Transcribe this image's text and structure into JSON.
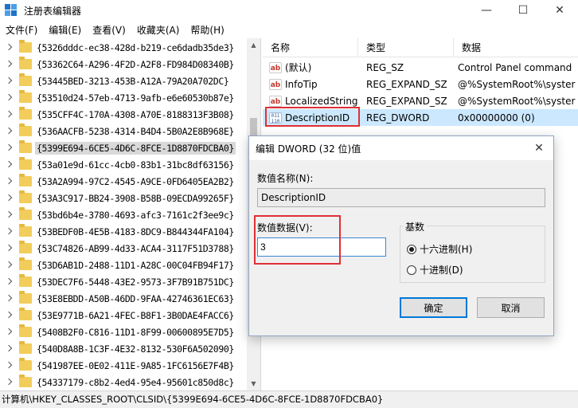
{
  "window": {
    "title": "注册表编辑器",
    "minimize": "—",
    "maximize": "☐",
    "close": "✕"
  },
  "menu": [
    "文件(F)",
    "编辑(E)",
    "查看(V)",
    "收藏夹(A)",
    "帮助(H)"
  ],
  "tree": {
    "selected_index": 7,
    "items": [
      "{5326dddc-ec38-428d-b219-ce6dadb35de3}",
      "{53362C64-A296-4F2D-A2F8-FD984D08340B}",
      "{53445BED-3213-453B-A12A-79A20A702DC}",
      "{53510d24-57eb-4713-9afb-e6e60530b87e}",
      "{535CFF4C-170A-4308-A70E-8188313F3B08}",
      "{536AACFB-5238-4314-B4D4-5B0A2E8B968E}",
      "{5399E694-6CE5-4D6C-8FCE-1D8870FDCBA0}",
      "{53a01e9d-61cc-4cb0-83b1-31bc8df63156}",
      "{53A2A994-97C2-4545-A9CE-0FD6405EA2B2}",
      "{53A3C917-BB24-3908-B58B-09ECDA99265F}",
      "{53bd6b4e-3780-4693-afc3-7161c2f3ee9c}",
      "{53BEDF0B-4E5B-4183-8DC9-B844344FA104}",
      "{53C74826-AB99-4d33-ACA4-3117F51D3788}",
      "{53D6AB1D-2488-11D1-A28C-00C04FB94F17}",
      "{53DEC7F6-5448-43E2-9573-3F7B91B751DC}",
      "{53E8EBDD-A50B-46DD-9FAA-42746361EC63}",
      "{53E9771B-6A21-4FEC-B8F1-3B0DAE4FACC6}",
      "{5408B2F0-C816-11D1-8F99-00600895E7D5}",
      "{540D8A8B-1C3F-4E32-8132-530F6A502090}",
      "{541987EE-0E02-411E-9A85-1FC6156E7F4B}",
      "{54337179-c8b2-4ed4-95e4-95601c850d8c}"
    ]
  },
  "values": {
    "headers": [
      "名称",
      "类型",
      "数据"
    ],
    "rows": [
      {
        "icon": "ab",
        "name": "(默认)",
        "type": "REG_SZ",
        "data": "Control Panel command"
      },
      {
        "icon": "ab",
        "name": "InfoTip",
        "type": "REG_EXPAND_SZ",
        "data": "@%SystemRoot%\\syster"
      },
      {
        "icon": "ab",
        "name": "LocalizedString",
        "type": "REG_EXPAND_SZ",
        "data": "@%SystemRoot%\\syster"
      },
      {
        "icon": "bin",
        "name": "DescriptionID",
        "type": "REG_DWORD",
        "data": "0x00000000 (0)"
      }
    ],
    "selected_index": 3
  },
  "icons": {
    "string_value": "ab",
    "binary_value": "011 110"
  },
  "statusbar": "计算机\\HKEY_CLASSES_ROOT\\CLSID\\{5399E694-6CE5-4D6C-8FCE-1D8870FDCBA0}",
  "dialog": {
    "title": "编辑 DWORD (32 位)值",
    "close": "✕",
    "name_label": "数值名称(N):",
    "name_value": "DescriptionID",
    "data_label": "数值数据(V):",
    "data_value": "3",
    "base_label": "基数",
    "hex_label": "十六进制(H)",
    "dec_label": "十进制(D)",
    "ok_label": "确定",
    "cancel_label": "取消"
  },
  "colors": {
    "highlight": "#e02f35",
    "selection": "#cce8ff",
    "accent": "#0078d7"
  }
}
